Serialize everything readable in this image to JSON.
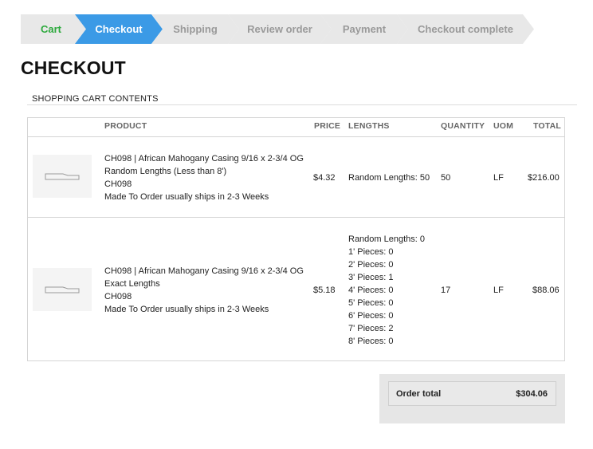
{
  "colors": {
    "accent": "#3b9ae6",
    "done": "#2eaa3e",
    "step_bg": "#e8e8e8",
    "muted": "#9a9a9a"
  },
  "steps": [
    {
      "label": "Cart",
      "state": "done"
    },
    {
      "label": "Checkout",
      "state": "active"
    },
    {
      "label": "Shipping",
      "state": "pending"
    },
    {
      "label": "Review order",
      "state": "pending"
    },
    {
      "label": "Payment",
      "state": "pending"
    },
    {
      "label": "Checkout complete",
      "state": "pending"
    }
  ],
  "page_title": "CHECKOUT",
  "cart": {
    "section_title": "SHOPPING CART CONTENTS",
    "columns": {
      "product": "PRODUCT",
      "price": "PRICE",
      "lengths": "LENGTHS",
      "quantity": "QUANTITY",
      "uom": "UOM",
      "total": "TOTAL"
    },
    "items": [
      {
        "thumbnail_icon": "molding-profile-icon",
        "name_line1": "CH098 | African Mahogany Casing 9/16 x 2-3/4 OG",
        "name_line2": "Random Lengths (Less than 8')",
        "sku": "CH098",
        "ship_note": "Made To Order usually ships in 2-3 Weeks",
        "price": "$4.32",
        "lengths": [
          "Random Lengths: 50"
        ],
        "quantity": "50",
        "uom": "LF",
        "total": "$216.00"
      },
      {
        "thumbnail_icon": "molding-profile-icon",
        "name_line1": "CH098 | African Mahogany Casing 9/16 x 2-3/4 OG",
        "name_line2": "Exact Lengths",
        "sku": "CH098",
        "ship_note": "Made To Order usually ships in 2-3 Weeks",
        "price": "$5.18",
        "lengths": [
          "Random Lengths: 0",
          "1' Pieces: 0",
          "2' Pieces: 0",
          "3' Pieces: 1",
          "4' Pieces: 0",
          "5' Pieces: 0",
          "6' Pieces: 0",
          "7' Pieces: 2",
          "8' Pieces: 0"
        ],
        "quantity": "17",
        "uom": "LF",
        "total": "$88.06"
      }
    ]
  },
  "order_total": {
    "label": "Order total",
    "value": "$304.06"
  }
}
